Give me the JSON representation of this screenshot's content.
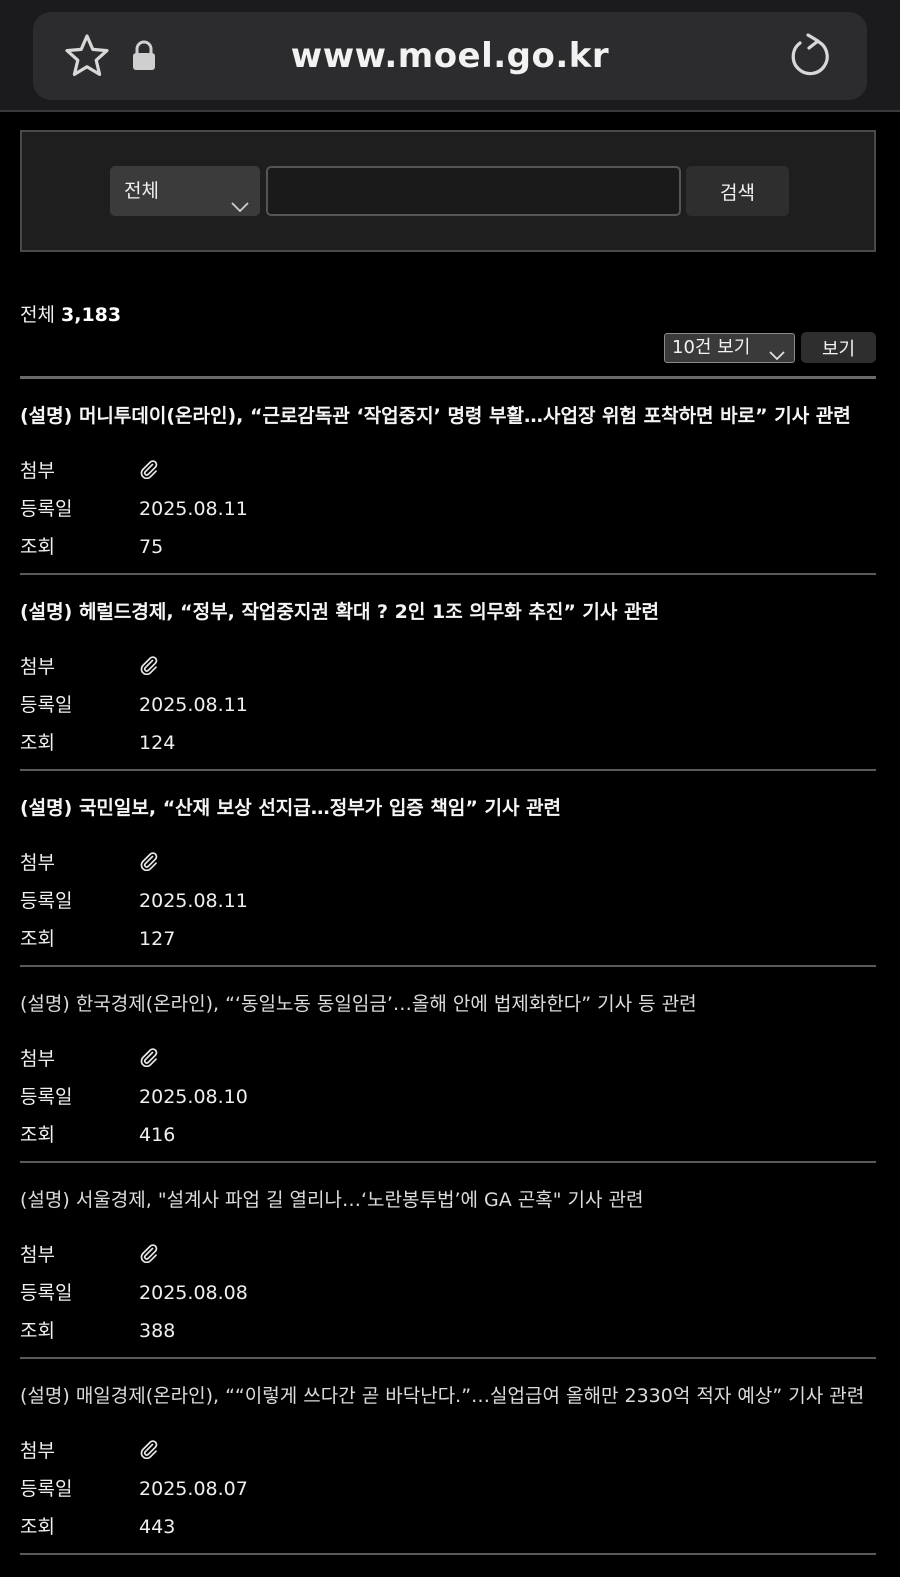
{
  "browser": {
    "url": "www.moel.go.kr",
    "icons": [
      "star-icon",
      "lock-icon",
      "reload-icon"
    ]
  },
  "search": {
    "category": "전체",
    "query": "",
    "button": "검색"
  },
  "summary": {
    "total_label": "전체",
    "total_count": "3,183",
    "page_size": "10건 보기",
    "view_button": "보기"
  },
  "labels": {
    "attach": "첨부",
    "date": "등록일",
    "views": "조회"
  },
  "items": [
    {
      "title": "(설명) 머니투데이(온라인), “근로감독관 ‘작업중지’ 명령 부활…사업장 위험 포착하면 바로” 기사 관련",
      "date": "2025.08.11",
      "views": "75"
    },
    {
      "title": "(설명) 헤럴드경제, “정부, 작업중지권 확대 ? 2인 1조 의무화 추진” 기사 관련",
      "date": "2025.08.11",
      "views": "124"
    },
    {
      "title": "(설명) 국민일보, “산재 보상 선지급…정부가 입증 책임” 기사 관련",
      "date": "2025.08.11",
      "views": "127"
    },
    {
      "title": "(설명) 한국경제(온라인), “‘동일노동 동일임금’…올해 안에 법제화한다” 기사 등 관련",
      "date": "2025.08.10",
      "views": "416"
    },
    {
      "title": "(설명) 서울경제, \"설계사 파업 길 열리나…‘노란봉투법’에 GA 곤혹\" 기사 관련",
      "date": "2025.08.08",
      "views": "388"
    },
    {
      "title": "(설명) 매일경제(온라인), ““이렇게 쓰다간 곧 바닥난다.”…실업급여 올해만 2330억 적자 예상” 기사 관련",
      "date": "2025.08.07",
      "views": "443"
    }
  ]
}
